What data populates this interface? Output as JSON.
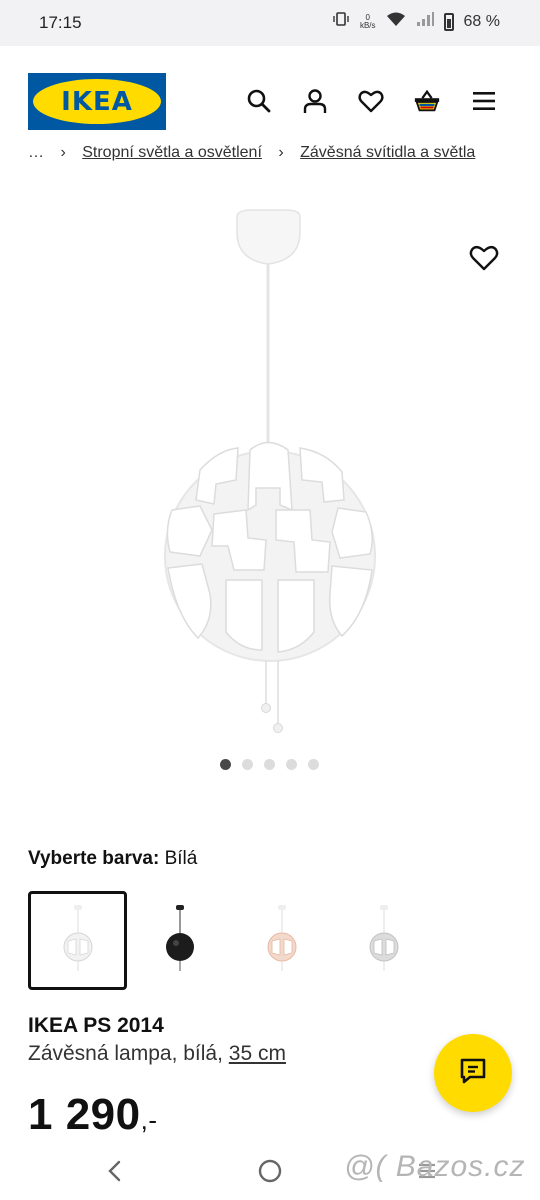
{
  "status_bar": {
    "time": "17:15",
    "net_speed_value": "0",
    "net_speed_unit": "kB/s",
    "battery": "68 %",
    "icons": [
      "vibrate-icon",
      "wifi-icon",
      "signal-icon",
      "battery-icon"
    ]
  },
  "header": {
    "logo_text": "IKEA",
    "icons": [
      "search-icon",
      "account-icon",
      "wishlist-icon",
      "basket-icon",
      "menu-icon"
    ],
    "brand_blue": "#0058a3",
    "brand_yellow": "#ffdb00"
  },
  "breadcrumb": {
    "ellipsis": "…",
    "items": [
      "Stropní světla a osvětlení",
      "Závěsná svítidla a světla"
    ]
  },
  "gallery": {
    "image_count": 5,
    "active_index": 0
  },
  "color_selector": {
    "label": "Vyberte barva:",
    "selected_value": "Bílá",
    "options": [
      "white",
      "black",
      "white-orange",
      "white-silver"
    ]
  },
  "product": {
    "name": "IKEA PS 2014",
    "description": "Závěsná lampa, bílá,",
    "size": "35 cm",
    "price": "1 290",
    "price_suffix": ",-"
  },
  "chat": {
    "icon": "chat-icon"
  },
  "nav_bar": {
    "icons": [
      "back-icon",
      "home-icon",
      "recents-icon"
    ]
  },
  "watermark": "@( Bazos.cz"
}
